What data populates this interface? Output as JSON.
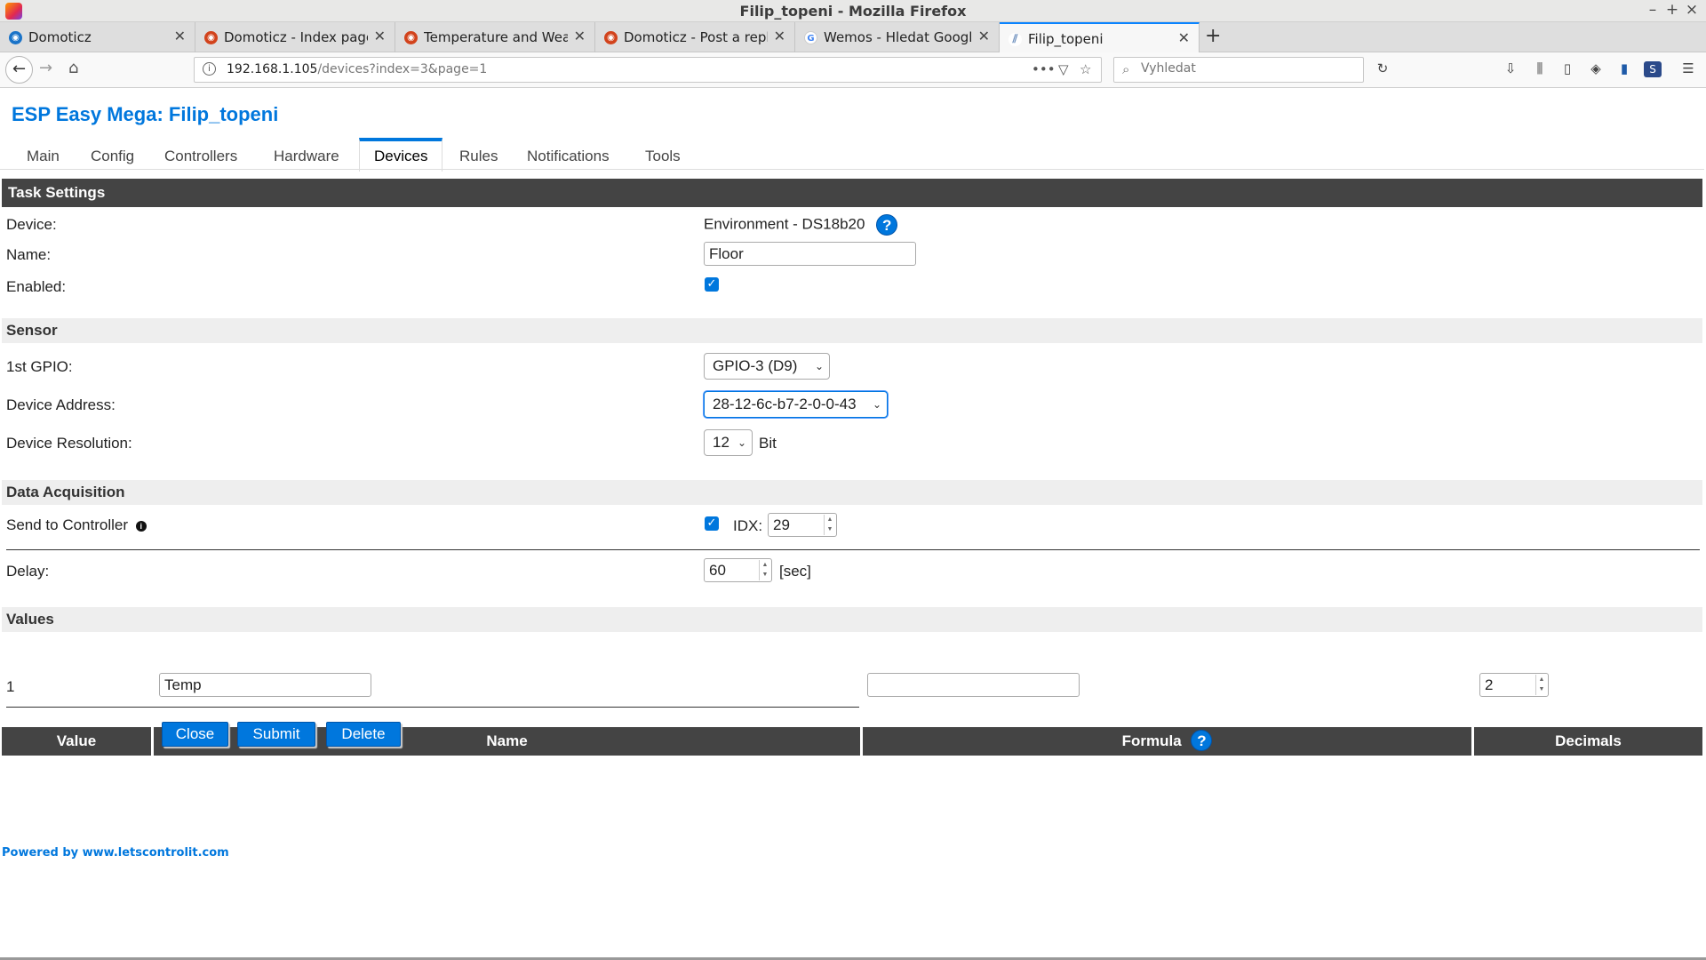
{
  "window": {
    "title": "Filip_topeni - Mozilla Firefox",
    "controls": [
      "–",
      "+",
      "×"
    ]
  },
  "tabs": [
    {
      "label": "Domoticz",
      "favicon_color": "#1a73c8"
    },
    {
      "label": "Domoticz - Index page",
      "favicon_color": "#d2431c"
    },
    {
      "label": "Temperature and Weather",
      "favicon_color": "#d2431c"
    },
    {
      "label": "Domoticz - Post a reply",
      "favicon_color": "#d2431c"
    },
    {
      "label": "Wemos - Hledat Googlem",
      "favicon_color": "#4285f4"
    },
    {
      "label": "Filip_topeni",
      "favicon_color": "#6d8fbd"
    }
  ],
  "new_tab": "+",
  "navbar": {
    "url_host": "192.168.1.105",
    "url_path": "/devices?index=3&page=1",
    "search_placeholder": "Vyhledat"
  },
  "page": {
    "title": "ESP Easy Mega: Filip_topeni",
    "menu": [
      "Main",
      "Config",
      "Controllers",
      "Hardware",
      "Devices",
      "Rules",
      "Notifications",
      "Tools"
    ],
    "active_menu": "Devices",
    "task_settings": {
      "header": "Task Settings",
      "device_label": "Device:",
      "device_value": "Environment - DS18b20",
      "name_label": "Name:",
      "name_value": "Floor",
      "enabled_label": "Enabled:",
      "enabled": true
    },
    "sensor": {
      "header": "Sensor",
      "gpio_label": "1st GPIO:",
      "gpio_value": "GPIO-3 (D9)",
      "address_label": "Device Address:",
      "address_value": "28-12-6c-b7-2-0-0-43",
      "resolution_label": "Device Resolution:",
      "resolution_value": "12",
      "resolution_unit": "Bit"
    },
    "data_acquisition": {
      "header": "Data Acquisition",
      "send_label": "Send to Controller",
      "send_enabled": true,
      "idx_label": "IDX:",
      "idx_value": "29",
      "delay_label": "Delay:",
      "delay_value": "60",
      "delay_unit": "[sec]"
    },
    "values": {
      "header": "Values",
      "columns": [
        "Value",
        "Name",
        "Formula",
        "Decimals"
      ],
      "rows": [
        {
          "value": "1",
          "name": "Temp",
          "formula": "",
          "decimals": "2"
        }
      ]
    },
    "buttons": {
      "close": "Close",
      "submit": "Submit",
      "delete": "Delete"
    },
    "footer": "Powered by www.letscontrolit.com",
    "help_glyph": "?",
    "info_glyph": "i"
  },
  "colors": {
    "accent": "#0077dd",
    "header_dark": "#444444",
    "section_light": "#eeeeee"
  }
}
